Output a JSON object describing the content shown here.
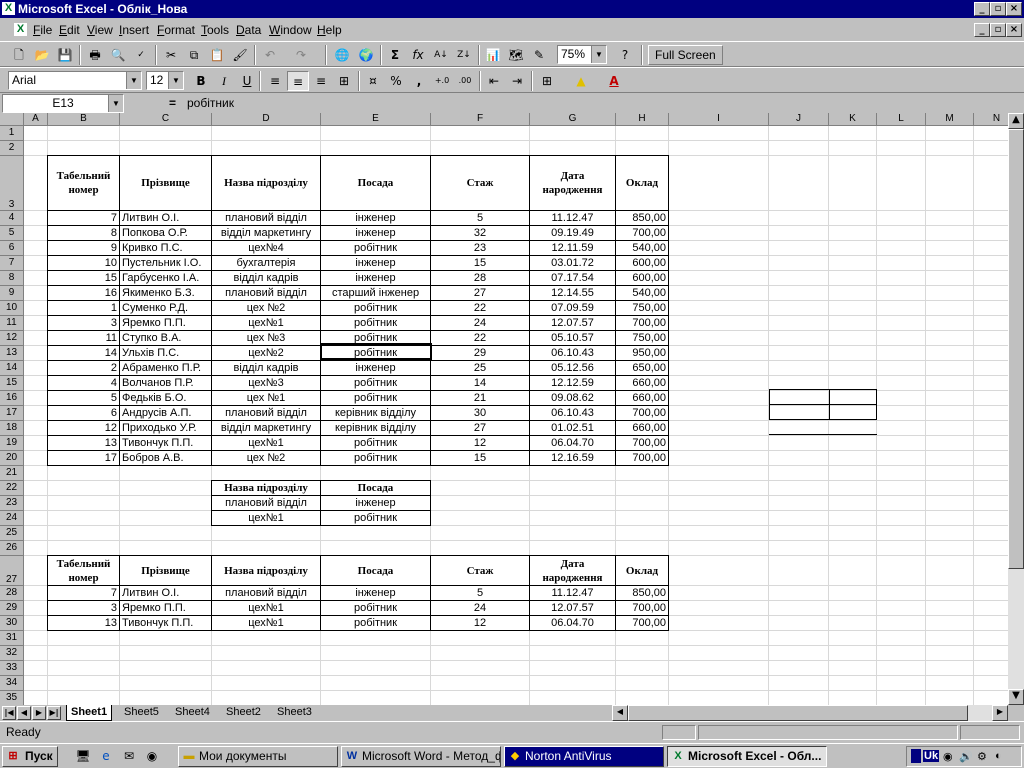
{
  "window": {
    "app_icon": "excel-icon",
    "title": "Microsoft Excel - Облік_Нова"
  },
  "menu": [
    "File",
    "Edit",
    "View",
    "Insert",
    "Format",
    "Tools",
    "Data",
    "Window",
    "Help"
  ],
  "toolbar": {
    "zoom": "75%",
    "full_screen": "Full Screen"
  },
  "format_toolbar": {
    "font": "Arial",
    "size": "12",
    "bold": "B",
    "italic": "I",
    "underline": "U",
    "percent": "%",
    "comma": ","
  },
  "formula_bar": {
    "name_box": "E13",
    "equals": "=",
    "content": "робітник"
  },
  "columns": [
    "A",
    "B",
    "C",
    "D",
    "E",
    "F",
    "G",
    "H",
    "I",
    "J",
    "K",
    "L",
    "M",
    "N"
  ],
  "rows": [
    "1",
    "2",
    "3",
    "4",
    "5",
    "6",
    "7",
    "8",
    "9",
    "10",
    "11",
    "12",
    "13",
    "14",
    "15",
    "16",
    "17",
    "18",
    "19",
    "20",
    "21",
    "22",
    "23",
    "24",
    "25",
    "26",
    "27",
    "28",
    "29",
    "30",
    "31",
    "32",
    "33",
    "34",
    "35",
    "36"
  ],
  "table1": {
    "headers": [
      "Табельний номер",
      "Прізвище",
      "Назва підрозділу",
      "Посада",
      "Стаж",
      "Дата народження",
      "Оклад"
    ],
    "rows": [
      [
        "7",
        "Литвин О.І.",
        "плановий відділ",
        "інженер",
        "5",
        "11.12.47",
        "850,00"
      ],
      [
        "8",
        "Попкова О.Р.",
        "відділ маркетингу",
        "інженер",
        "32",
        "09.19.49",
        "700,00"
      ],
      [
        "9",
        "Кривко П.С.",
        "цех№4",
        "робітник",
        "23",
        "12.11.59",
        "540,00"
      ],
      [
        "10",
        "Пустельник І.О.",
        "бухгалтерія",
        "інженер",
        "15",
        "03.01.72",
        "600,00"
      ],
      [
        "15",
        "Гарбусенко І.А.",
        "відділ кадрів",
        "інженер",
        "28",
        "07.17.54",
        "600,00"
      ],
      [
        "16",
        "Якименко Б.З.",
        "плановий відділ",
        "старший інженер",
        "27",
        "12.14.55",
        "540,00"
      ],
      [
        "1",
        "Суменко Р.Д.",
        "цех №2",
        "робітник",
        "22",
        "07.09.59",
        "750,00"
      ],
      [
        "3",
        "Яремко П.П.",
        "цех№1",
        "робітник",
        "24",
        "12.07.57",
        "700,00"
      ],
      [
        "11",
        "Ступко В.А.",
        "цех №3",
        "робітник",
        "22",
        "05.10.57",
        "750,00"
      ],
      [
        "14",
        "Ульхів П.С.",
        "цех№2",
        "робітник",
        "29",
        "06.10.43",
        "950,00"
      ],
      [
        "2",
        "Абраменко П.Р.",
        "відділ кадрів",
        "інженер",
        "25",
        "05.12.56",
        "650,00"
      ],
      [
        "4",
        "Волчанов П.Р.",
        "цех№3",
        "робітник",
        "14",
        "12.12.59",
        "660,00"
      ],
      [
        "5",
        "Федьків Б.О.",
        "цех №1",
        "робітник",
        "21",
        "09.08.62",
        "660,00"
      ],
      [
        "6",
        "Андрусів А.П.",
        "плановий відділ",
        "керівник відділу",
        "30",
        "06.10.43",
        "700,00"
      ],
      [
        "12",
        "Приходько У.Р.",
        "відділ маркетингу",
        "керівник відділу",
        "27",
        "01.02.51",
        "660,00"
      ],
      [
        "13",
        "Тивончук П.П.",
        "цех№1",
        "робітник",
        "12",
        "06.04.70",
        "700,00"
      ],
      [
        "17",
        "Бобров А.В.",
        "цех №2",
        "робітник",
        "15",
        "12.16.59",
        "700,00"
      ]
    ]
  },
  "criteria": {
    "headers": [
      "Назва підрозділу",
      "Посада"
    ],
    "rows": [
      [
        "плановий відділ",
        "інженер"
      ],
      [
        "цех№1",
        "робітник"
      ]
    ]
  },
  "table2": {
    "headers": [
      "Табельний номер",
      "Прізвище",
      "Назва підрозділу",
      "Посада",
      "Стаж",
      "Дата народження",
      "Оклад"
    ],
    "rows": [
      [
        "7",
        "Литвин О.І.",
        "плановий відділ",
        "інженер",
        "5",
        "11.12.47",
        "850,00"
      ],
      [
        "3",
        "Яремко П.П.",
        "цех№1",
        "робітник",
        "24",
        "12.07.57",
        "700,00"
      ],
      [
        "13",
        "Тивончук П.П.",
        "цех№1",
        "робітник",
        "12",
        "06.04.70",
        "700,00"
      ]
    ]
  },
  "sheets": [
    "Sheet1",
    "Sheet5",
    "Sheet4",
    "Sheet2",
    "Sheet3"
  ],
  "status": "Ready",
  "taskbar": {
    "start": "Пуск",
    "tasks": [
      "Мои документы",
      "Microsoft Word - Метод_ф...",
      "Norton AntiVirus",
      "Microsoft Excel - Обл..."
    ],
    "tray_lang": "Uk"
  }
}
